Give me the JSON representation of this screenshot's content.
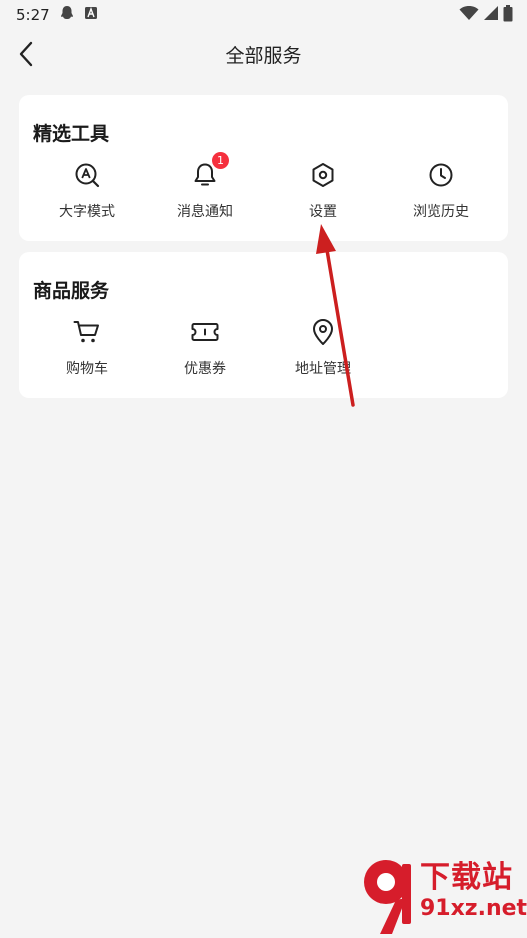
{
  "status_bar": {
    "time": "5:27"
  },
  "header": {
    "title": "全部服务"
  },
  "sections": [
    {
      "title": "精选工具",
      "items": [
        {
          "label": "大字模式",
          "icon": "large-font-icon"
        },
        {
          "label": "消息通知",
          "icon": "bell-icon",
          "badge": "1"
        },
        {
          "label": "设置",
          "icon": "settings-hexagon-icon"
        },
        {
          "label": "浏览历史",
          "icon": "clock-icon"
        }
      ]
    },
    {
      "title": "商品服务",
      "items": [
        {
          "label": "购物车",
          "icon": "cart-icon"
        },
        {
          "label": "优惠券",
          "icon": "coupon-icon"
        },
        {
          "label": "地址管理",
          "icon": "location-pin-icon"
        }
      ]
    }
  ],
  "watermark": {
    "text": "下载站",
    "url": "91xz.net"
  },
  "colors": {
    "accent": "#f5303e",
    "annotation_arrow": "#cc1f1f",
    "watermark": "#d61d2b"
  }
}
